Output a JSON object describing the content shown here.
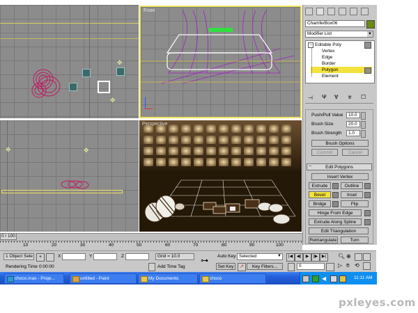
{
  "viewports": {
    "front_label": "Front",
    "perspective_label": "Perspective"
  },
  "command_panel": {
    "object_name": "ChamferBox06",
    "modifier_list": "Modifier List",
    "stack": {
      "editable_poly": "Editable Poly",
      "sub": [
        "Vertex",
        "Edge",
        "Border",
        "Polygon",
        "Element"
      ],
      "selected": "Polygon"
    },
    "paint": {
      "push_pull_label": "Push/Pull Value",
      "push_pull_value": "10.0",
      "brush_size_label": "Brush Size",
      "brush_size_value": "20.0",
      "brush_strength_label": "Brush Strength",
      "brush_strength_value": "1.0",
      "brush_options": "Brush Options",
      "commit": "Commit",
      "cancel": "Cancel"
    },
    "edit_polygons": {
      "title": "Edit Polygons",
      "insert_vertex": "Insert Vertex",
      "extrude": "Extrude",
      "outline": "Outline",
      "bevel": "Bevel",
      "inset": "Inset",
      "bridge": "Bridge",
      "flip": "Flip",
      "hinge": "Hinge From Edge",
      "extrude_spline": "Extrude Along Spline",
      "edit_triangulation": "Edit Triangulation",
      "retriangulate": "Retriangulate",
      "turn": "Turn"
    }
  },
  "timeline": {
    "frame": "0 / 100",
    "ticks": [
      "10",
      "20",
      "30",
      "40",
      "50",
      "60",
      "70",
      "80",
      "90",
      "100"
    ]
  },
  "status": {
    "selection": "1 Object Sele",
    "x_label": "X",
    "y_label": "Y",
    "z_label": "Z",
    "grid": "Grid = 10.0",
    "auto_key": "Auto Key",
    "set_key": "Set Key",
    "selected_option": "Selected",
    "key_filters": "Key Filters...",
    "rendering_label": "Rendering Time",
    "rendering_time": "0:00:00",
    "add_time_tag": "Add Time Tag",
    "frame_value": "0"
  },
  "taskbar": {
    "items": [
      "choco.max - Proje...",
      "untitled - Paint",
      "My Documents",
      "choco"
    ],
    "clock": "11:11 AM"
  },
  "watermark": "pxleyes.com",
  "colors": {
    "viewport_bg": "#8c8c8c",
    "active_border": "#f0e060",
    "taskbar": "#245edb",
    "selected_item": "#f4e23c"
  }
}
